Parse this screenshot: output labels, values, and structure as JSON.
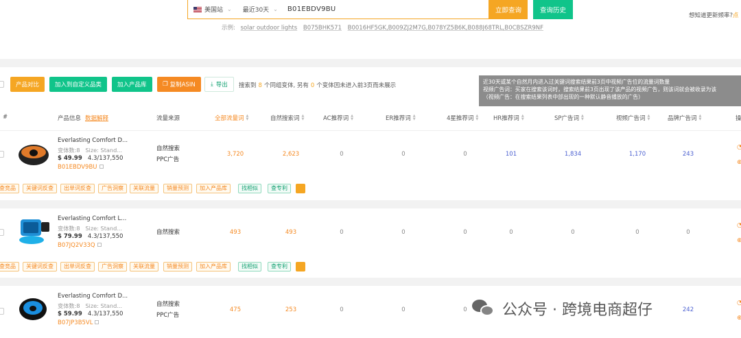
{
  "search": {
    "site": "美国站",
    "period": "最近30天",
    "asin": "B01EBDV9BU",
    "search_btn": "立即查询",
    "history_btn": "查询历史",
    "freq_link": "想知道更新频率?",
    "freq_dot": "点",
    "examples_label": "示例:",
    "examples": [
      "solar outdoor lights",
      "B075BHK571",
      "B0016HF5GK,B009ZJ2M7G,B078YZ5B6K,B088J68TRL,B0CBSZR9NF"
    ]
  },
  "toolbar": {
    "compare": "产品对比",
    "add_custom": "加入到自定义品类",
    "add_library": "加入产品库",
    "copy_asin": "复制ASIN",
    "export": "导出",
    "summary_pre": "搜索到",
    "summary_count": "8",
    "summary_mid": "个同组变体, 另有",
    "summary_excluded": "0",
    "summary_post": "个变体因未进入前3页而未展示"
  },
  "tooltip": {
    "line1": "近30天或某个自然月内进入过关键词搜索结果前3页中视频广告位的流量词数量",
    "line2": "视频广告词：买家在搜索该词时，搜索结果前3页出现了该产品的视频广告，则该词就会被收录为该",
    "line3": "（视频广告：在搜索结果列表中部出现的一种默认静音播放的广告）"
  },
  "headers": {
    "index": "#",
    "product": "产品信息",
    "data_explain": "数据解释",
    "source": "流量来源",
    "all": "全部流量词",
    "organic": "自然搜索词",
    "ac": "AC推荐词",
    "er": "ER推荐词",
    "star4": "4星推荐词",
    "hr": "HR推荐词",
    "sp": "SP广告词",
    "video": "视频广告词",
    "brand": "品牌广告词",
    "more": "操"
  },
  "rows": [
    {
      "name": "Everlasting Comfort D...",
      "variants": "变体数:8",
      "size": "Size: Stand...",
      "price": "$ 49.99",
      "rating": "4.3/137,550",
      "asin": "B01EBDV9BU",
      "source1": "自然搜索",
      "source2": "PPC广告",
      "all": "3,720",
      "organic": "2,623",
      "ac": "0",
      "er": "0",
      "star4": "0",
      "hr": "101",
      "sp": "1,834",
      "video": "1,170",
      "brand": "243"
    },
    {
      "name": "Everlasting Comfort L...",
      "variants": "变体数:8",
      "size": "Size: Stand...",
      "price": "$ 79.99",
      "rating": "4.3/137,550",
      "asin": "B07JQ2V33Q",
      "source1": "自然搜索",
      "source2": "",
      "all": "493",
      "organic": "493",
      "ac": "0",
      "er": "0",
      "star4": "0",
      "hr": "0",
      "sp": "0",
      "video": "0",
      "brand": "0"
    },
    {
      "name": "Everlasting Comfort D...",
      "variants": "变体数:8",
      "size": "Size: Stand...",
      "price": "$ 59.99",
      "rating": "4.3/137,550",
      "asin": "B07JP3B5VL",
      "source1": "自然搜索",
      "source2": "PPC广告",
      "all": "475",
      "organic": "253",
      "ac": "0",
      "er": "0",
      "star4": "0",
      "hr": "",
      "sp": "",
      "video": "",
      "brand": "242"
    }
  ],
  "tags": [
    "查竞品",
    "关键词反查",
    "出单词反查",
    "广告洞察",
    "关联流量",
    "销量预测",
    "加入产品库",
    "找相似",
    "查专利"
  ],
  "watermark": "公众号 · 跨境电商超仔",
  "colors": {
    "orange": "#f5a623",
    "green": "#10c48a",
    "blue": "#4a5fd0"
  }
}
